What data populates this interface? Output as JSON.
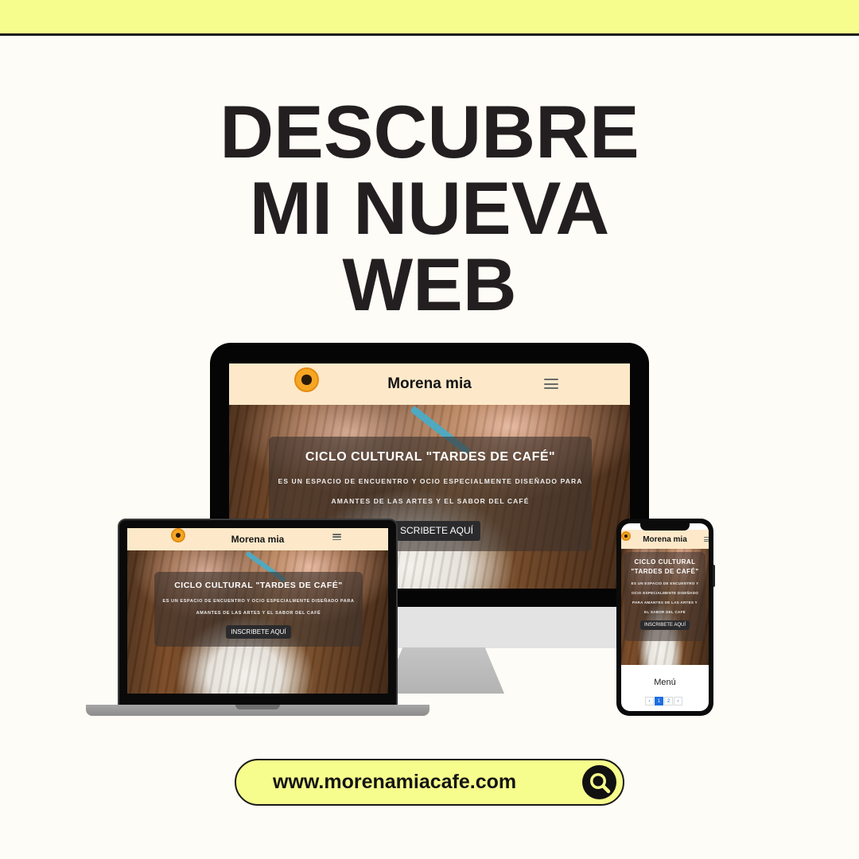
{
  "headline": {
    "line1": "DESCUBRE",
    "line2": "MI NUEVA",
    "line3": "WEB"
  },
  "site": {
    "brand": "Morena mia",
    "hero_title": "CICLO CULTURAL \"TARDES DE CAFÉ\"",
    "hero_sub_line1": "ES UN ESPACIO DE ENCUENTRO Y OCIO ESPECIALMENTE DISEÑADO PARA",
    "hero_sub_line2": "AMANTES DE LAS ARTES Y EL SABOR DEL CAFÉ",
    "cta": "INSCRIBETE AQUÍ"
  },
  "desktop": {
    "cta_visible": "SCRIBETE AQUÍ"
  },
  "phone": {
    "hero_title_line1": "CICLO CULTURAL",
    "hero_title_line2": "\"TARDES DE CAFÉ\"",
    "sub_line1": "ES UN ESPACIO DE ENCUENTRO Y",
    "sub_line2": "OCIO ESPECIALMENTE DISEÑADO",
    "sub_line3": "PARA AMANTES DE LAS ARTES Y",
    "sub_line4": "EL SABOR DEL CAFÉ",
    "menu_label": "Menú",
    "pager": [
      "‹",
      "1",
      "2",
      "›"
    ]
  },
  "url": "www.morenamiacafe.com",
  "icons": {
    "search": "search-icon",
    "menu": "hamburger-menu-icon",
    "logo": "cafe-logo-icon"
  },
  "colors": {
    "accent_yellow": "#f6fd8c",
    "background": "#fdfcf6",
    "nav_peach": "#fde9c9",
    "text_dark": "#231f20",
    "pager_blue": "#1f6fe0"
  }
}
